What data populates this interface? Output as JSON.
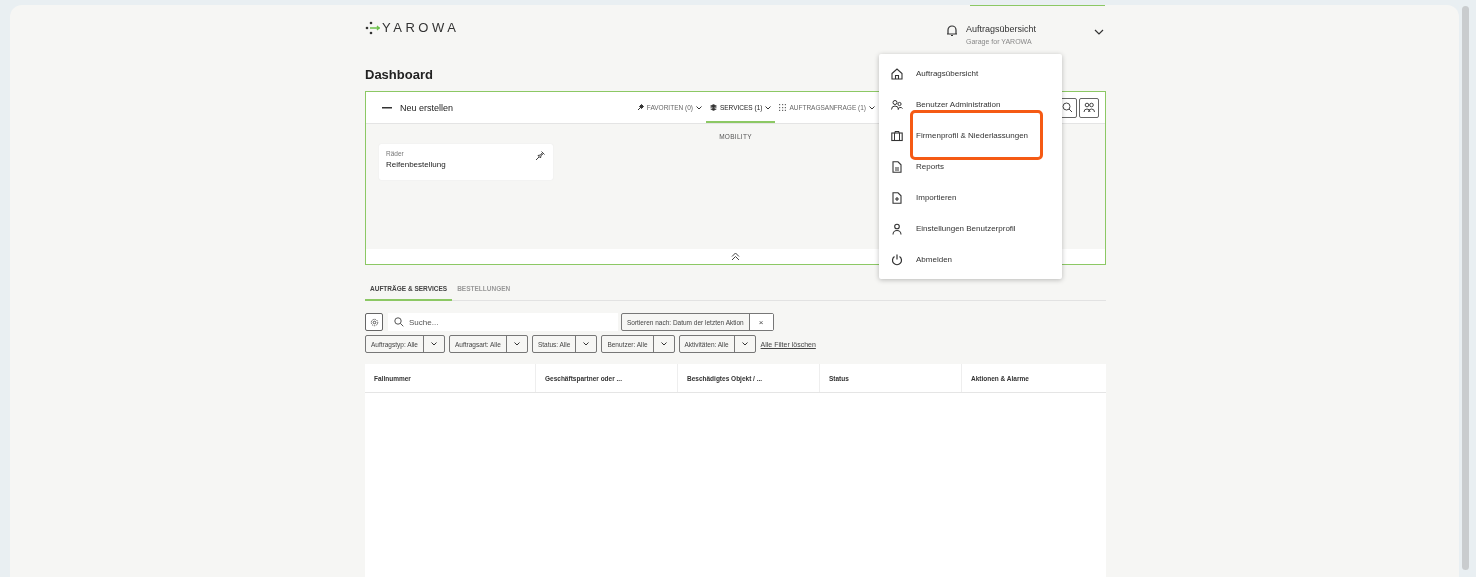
{
  "header": {
    "logo": "YAROWA",
    "account": {
      "title": "Auftragsübersicht",
      "subtitle": "Garage for YAROWA"
    }
  },
  "page_title": "Dashboard",
  "create_panel": {
    "title": "Neu erstellen",
    "tabs": [
      {
        "label": "FAVORITEN (0)",
        "selected": false
      },
      {
        "label": "SERVICES (1)",
        "selected": true
      },
      {
        "label": "AUFTRAGSANFRAGE (1)",
        "selected": false
      }
    ],
    "section": "MOBILITY",
    "tiles": [
      {
        "category": "Räder",
        "name": "Reifenbestellung"
      }
    ]
  },
  "tabs": [
    {
      "label": "AUFTRÄGE & SERVICES",
      "selected": true
    },
    {
      "label": "BESTELLUNGEN",
      "selected": false
    }
  ],
  "search": {
    "placeholder": "Suche..."
  },
  "sort": {
    "label": "Sortieren nach: Datum der letzten Aktion",
    "clear": "×"
  },
  "filters": [
    {
      "label": "Auftragstyp: Alle"
    },
    {
      "label": "Auftragsart: Alle"
    },
    {
      "label": "Status: Alle"
    },
    {
      "label": "Benutzer: Alle"
    },
    {
      "label": "Aktivitäten: Alle"
    }
  ],
  "clear_filters": "Alle Filter löschen",
  "table": {
    "columns": [
      "Fallnummer",
      "Geschäftspartner oder ...",
      "Beschädigtes Objekt / ...",
      "Status",
      "Aktionen & Alarme"
    ]
  },
  "menu": {
    "items": [
      {
        "label": "Auftragsübersicht"
      },
      {
        "label": "Benutzer Administration"
      },
      {
        "label": "Firmenprofil & Niederlassungen"
      },
      {
        "label": "Reports"
      },
      {
        "label": "Importieren"
      },
      {
        "label": "Einstellungen Benutzerprofil"
      },
      {
        "label": "Abmelden"
      }
    ]
  }
}
